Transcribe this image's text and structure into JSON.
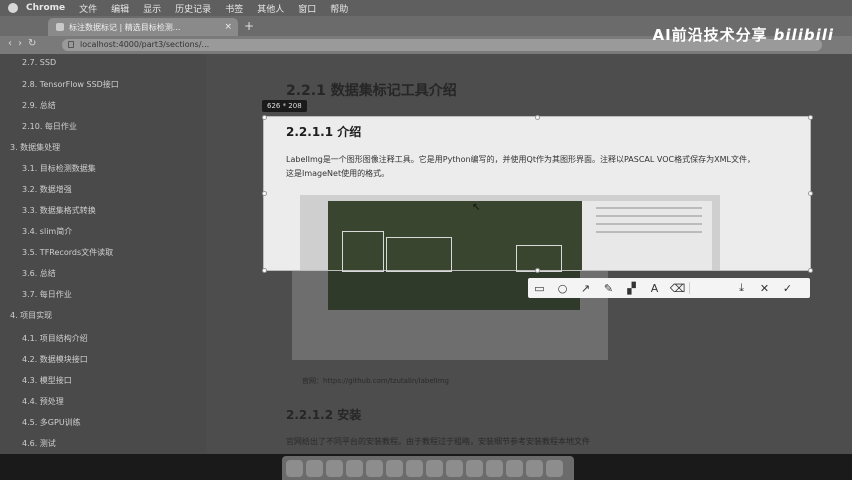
{
  "menubar": {
    "app": "Chrome",
    "items": [
      "文件",
      "编辑",
      "显示",
      "历史记录",
      "书签",
      "其他人",
      "窗口",
      "帮助"
    ]
  },
  "browser": {
    "tab_title": "标注数据标记 | 精选目标检测...",
    "url": "localhost:4000/part3/sections/..."
  },
  "watermark": {
    "text": "AI前沿技术分享",
    "brand": "bilibili"
  },
  "sidebar": {
    "items": [
      {
        "label": "2.7. SSD",
        "level": 2
      },
      {
        "label": "2.8. TensorFlow SSD接口",
        "level": 2
      },
      {
        "label": "2.9. 总结",
        "level": 2
      },
      {
        "label": "2.10. 每日作业",
        "level": 2
      },
      {
        "label": "3. 数据集处理",
        "level": 1
      },
      {
        "label": "3.1. 目标检测数据集",
        "level": 2
      },
      {
        "label": "3.2. 数据增强",
        "level": 2
      },
      {
        "label": "3.3. 数据集格式转换",
        "level": 2
      },
      {
        "label": "3.4. slim简介",
        "level": 2
      },
      {
        "label": "3.5. TFRecords文件读取",
        "level": 2
      },
      {
        "label": "3.6. 总结",
        "level": 2
      },
      {
        "label": "3.7. 每日作业",
        "level": 2
      },
      {
        "label": "4. 项目实现",
        "level": 1
      },
      {
        "label": "4.1. 项目结构介绍",
        "level": 2
      },
      {
        "label": "4.2. 数据模块接口",
        "level": 2
      },
      {
        "label": "4.3. 模型接口",
        "level": 2
      },
      {
        "label": "4.4. 预处理",
        "level": 2
      },
      {
        "label": "4.5. 多GPU训练",
        "level": 2
      },
      {
        "label": "4.6. 测试",
        "level": 2
      }
    ]
  },
  "main": {
    "heading": "2.2.1 数据集标记工具介绍",
    "caption": "官网：https://github.com/tzutalin/labelImg",
    "heading2": "2.2.1.2 安装",
    "install_text": "官网给出了不同平台的安装教程。由于教程过于粗略，安装细节参考安装教程本地文件"
  },
  "selection": {
    "size_label": "626 * 208",
    "heading": "2.2.1.1 介绍",
    "paragraph": "LabelImg是一个图形图像注释工具。它是用Python编写的，并使用Qt作为其图形界面。注释以PASCAL VOC格式保存为XML文件，这是ImageNet使用的格式。"
  },
  "toolbar": {
    "tools": [
      {
        "name": "rectangle",
        "glyph": "▭"
      },
      {
        "name": "ellipse",
        "glyph": "○"
      },
      {
        "name": "arrow",
        "glyph": "↗"
      },
      {
        "name": "pencil",
        "glyph": "✎"
      },
      {
        "name": "mosaic",
        "glyph": "▞"
      },
      {
        "name": "text",
        "glyph": "A"
      },
      {
        "name": "eraser",
        "glyph": "⌫"
      }
    ],
    "actions": [
      {
        "name": "download",
        "glyph": "⤓"
      },
      {
        "name": "cancel",
        "glyph": "✕"
      },
      {
        "name": "confirm",
        "glyph": "✓"
      }
    ]
  }
}
